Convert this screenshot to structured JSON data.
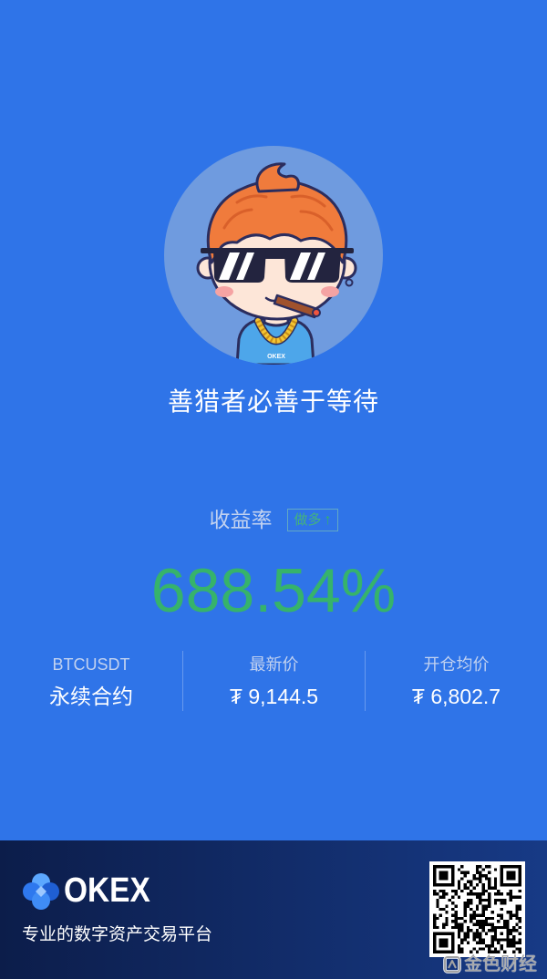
{
  "theme": {
    "background": "#2f74e8",
    "avatar_ring": "#6f9bdf",
    "positive_green": "#36b36b",
    "label_color": "#c2d2f0",
    "footer_gradient_start": "#0c1d4a",
    "footer_gradient_end": "#173a86"
  },
  "profile": {
    "avatar_icon": "trader-avatar-sunglasses-icon",
    "avatar_shirt_text": "OKEX",
    "motto": "善猎者必善于等待"
  },
  "performance": {
    "yield_label": "收益率",
    "position_side": "做多",
    "position_arrow": "↑",
    "yield_value": "688.54%"
  },
  "details": [
    {
      "label": "BTCUSDT",
      "value": "永续合约"
    },
    {
      "label": "最新价",
      "value": "₮ 9,144.5"
    },
    {
      "label": "开仓均价",
      "value": "₮ 6,802.7"
    }
  ],
  "footer": {
    "logo_icon": "okex-logo-icon",
    "brand": "OKEX",
    "tagline": "专业的数字资产交易平台",
    "qr_icon": "qr-code-icon"
  },
  "watermark": {
    "icon": "jinse-logo-icon",
    "text": "金色财经"
  }
}
